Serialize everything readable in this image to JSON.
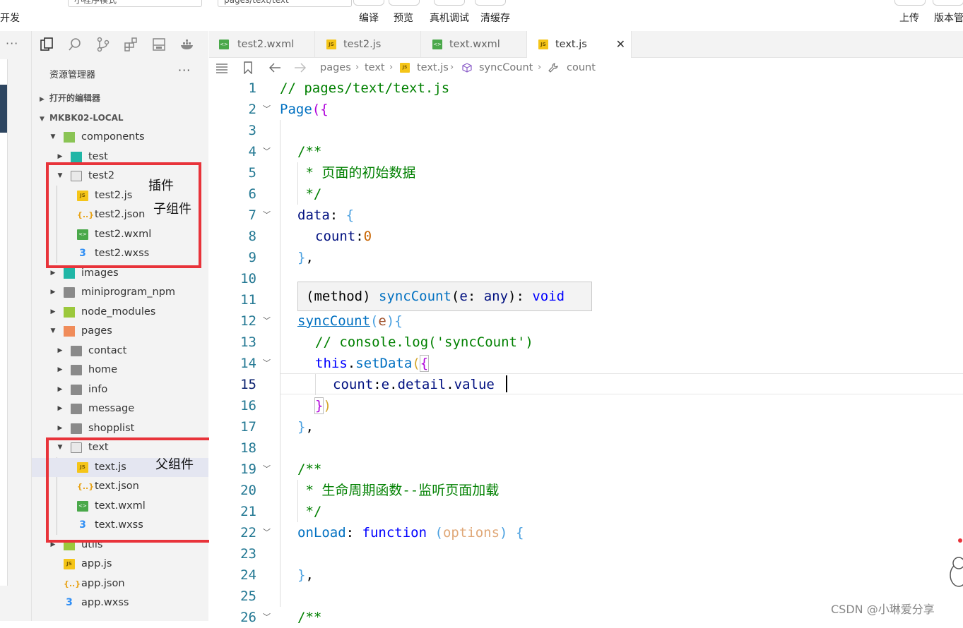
{
  "toolbar": {
    "left_fragment": "开发",
    "mode_select": "小程序模式",
    "path_field": "pages/text/text",
    "buttons": [
      "编译",
      "预览",
      "真机调试",
      "清缓存"
    ],
    "right_buttons": [
      "上传",
      "版本管"
    ]
  },
  "explorer": {
    "title": "资源管理器",
    "more": "···",
    "sections": [
      "打开的编辑器",
      "MKBK02-LOCAL"
    ],
    "tree": [
      {
        "label": "components",
        "icon": "folder-components-icon",
        "depth": 0,
        "expanded": true
      },
      {
        "label": "test",
        "icon": "folder-teal-icon",
        "depth": 1,
        "expanded": false
      },
      {
        "label": "test2",
        "icon": "folder-open-icon",
        "depth": 1,
        "expanded": true
      },
      {
        "label": "test2.js",
        "icon": "js-file-icon",
        "depth": 2
      },
      {
        "label": "test2.json",
        "icon": "json-file-icon",
        "depth": 2
      },
      {
        "label": "test2.wxml",
        "icon": "wxml-file-icon",
        "depth": 2
      },
      {
        "label": "test2.wxss",
        "icon": "wxss-file-icon",
        "depth": 2
      },
      {
        "label": "images",
        "icon": "folder-images-icon",
        "depth": 0,
        "expanded": false
      },
      {
        "label": "miniprogram_npm",
        "icon": "folder-icon",
        "depth": 0,
        "expanded": false
      },
      {
        "label": "node_modules",
        "icon": "folder-node-icon",
        "depth": 0,
        "expanded": false
      },
      {
        "label": "pages",
        "icon": "folder-pages-icon",
        "depth": 0,
        "expanded": true
      },
      {
        "label": "contact",
        "icon": "folder-icon",
        "depth": 1,
        "expanded": false
      },
      {
        "label": "home",
        "icon": "folder-icon",
        "depth": 1,
        "expanded": false
      },
      {
        "label": "info",
        "icon": "folder-icon",
        "depth": 1,
        "expanded": false
      },
      {
        "label": "message",
        "icon": "folder-icon",
        "depth": 1,
        "expanded": false
      },
      {
        "label": "shopplist",
        "icon": "folder-icon",
        "depth": 1,
        "expanded": false
      },
      {
        "label": "text",
        "icon": "folder-open-icon",
        "depth": 1,
        "expanded": true
      },
      {
        "label": "text.js",
        "icon": "js-file-icon",
        "depth": 2,
        "selected": true
      },
      {
        "label": "text.json",
        "icon": "json-file-icon",
        "depth": 2
      },
      {
        "label": "text.wxml",
        "icon": "wxml-file-icon",
        "depth": 2
      },
      {
        "label": "text.wxss",
        "icon": "wxss-file-icon",
        "depth": 2
      },
      {
        "label": "utils",
        "icon": "folder-utils-icon",
        "depth": 0,
        "expanded": false
      },
      {
        "label": "app.js",
        "icon": "js-file-icon",
        "depth": 0
      },
      {
        "label": "app.json",
        "icon": "json-file-icon",
        "depth": 0
      },
      {
        "label": "app.wxss",
        "icon": "wxss-file-icon",
        "depth": 0
      }
    ]
  },
  "annotations": {
    "plugin": "插件",
    "child": "子组件",
    "parent": "父组件"
  },
  "tabs": [
    {
      "label": "test2.wxml",
      "icon": "wxml-file-icon"
    },
    {
      "label": "test2.js",
      "icon": "js-file-icon"
    },
    {
      "label": "text.wxml",
      "icon": "wxml-file-icon"
    },
    {
      "label": "text.js",
      "icon": "js-file-icon",
      "active": true
    }
  ],
  "tab_close": "✕",
  "breadcrumb": [
    "pages",
    "text",
    "text.js",
    "syncCount",
    "count"
  ],
  "editor": {
    "line_numbers": [
      "1",
      "2",
      "3",
      "4",
      "5",
      "6",
      "7",
      "8",
      "9",
      "10",
      "11",
      "12",
      "13",
      "14",
      "15",
      "16",
      "17",
      "18",
      "19",
      "20",
      "21",
      "22",
      "23",
      "24",
      "25",
      "26"
    ],
    "current_line": "15",
    "code": {
      "l1": "// pages/text/text.js",
      "l2a": "Page",
      "l2b": "({",
      "l4": "/**",
      "l5": " * 页面的初始数据",
      "l6": " */",
      "l7a": "data",
      "l7b": ": ",
      "l7c": "{",
      "l8a": "count",
      "l8b": ":",
      "l8c": "0",
      "l9a": "}",
      "l9b": ",",
      "l12a": "syncCount",
      "l12b": "(",
      "l12c": "e",
      "l12d": ")",
      "l12e": "{",
      "l13": "// console.log('syncCount')",
      "l14a": "this",
      "l14b": ".",
      "l14c": "setData",
      "l14d": "(",
      "l14e": "{",
      "l15a": "count",
      "l15b": ":",
      "l15c": "e",
      "l15d": ".",
      "l15e": "detail",
      "l15f": ".",
      "l15g": "value",
      "l16a": "}",
      "l16b": ")",
      "l17a": "}",
      "l17b": ",",
      "l19": "/**",
      "l20": " * 生命周期函数--监听页面加载",
      "l21": " */",
      "l22a": "onLoad",
      "l22b": ": ",
      "l22c": "function",
      "l22d": " ",
      "l22e": "(",
      "l22f": "options",
      "l22g": ")",
      "l22h": " ",
      "l22i": "{",
      "l24a": "}",
      "l24b": ",",
      "l26": "/**"
    },
    "tooltip": {
      "a": "(method) ",
      "b": "syncCount",
      "c": "(",
      "d": "e",
      "e": ": ",
      "f": "any",
      "g": "): ",
      "h": "void"
    }
  },
  "watermark": "CSDN @小琳爱分享"
}
